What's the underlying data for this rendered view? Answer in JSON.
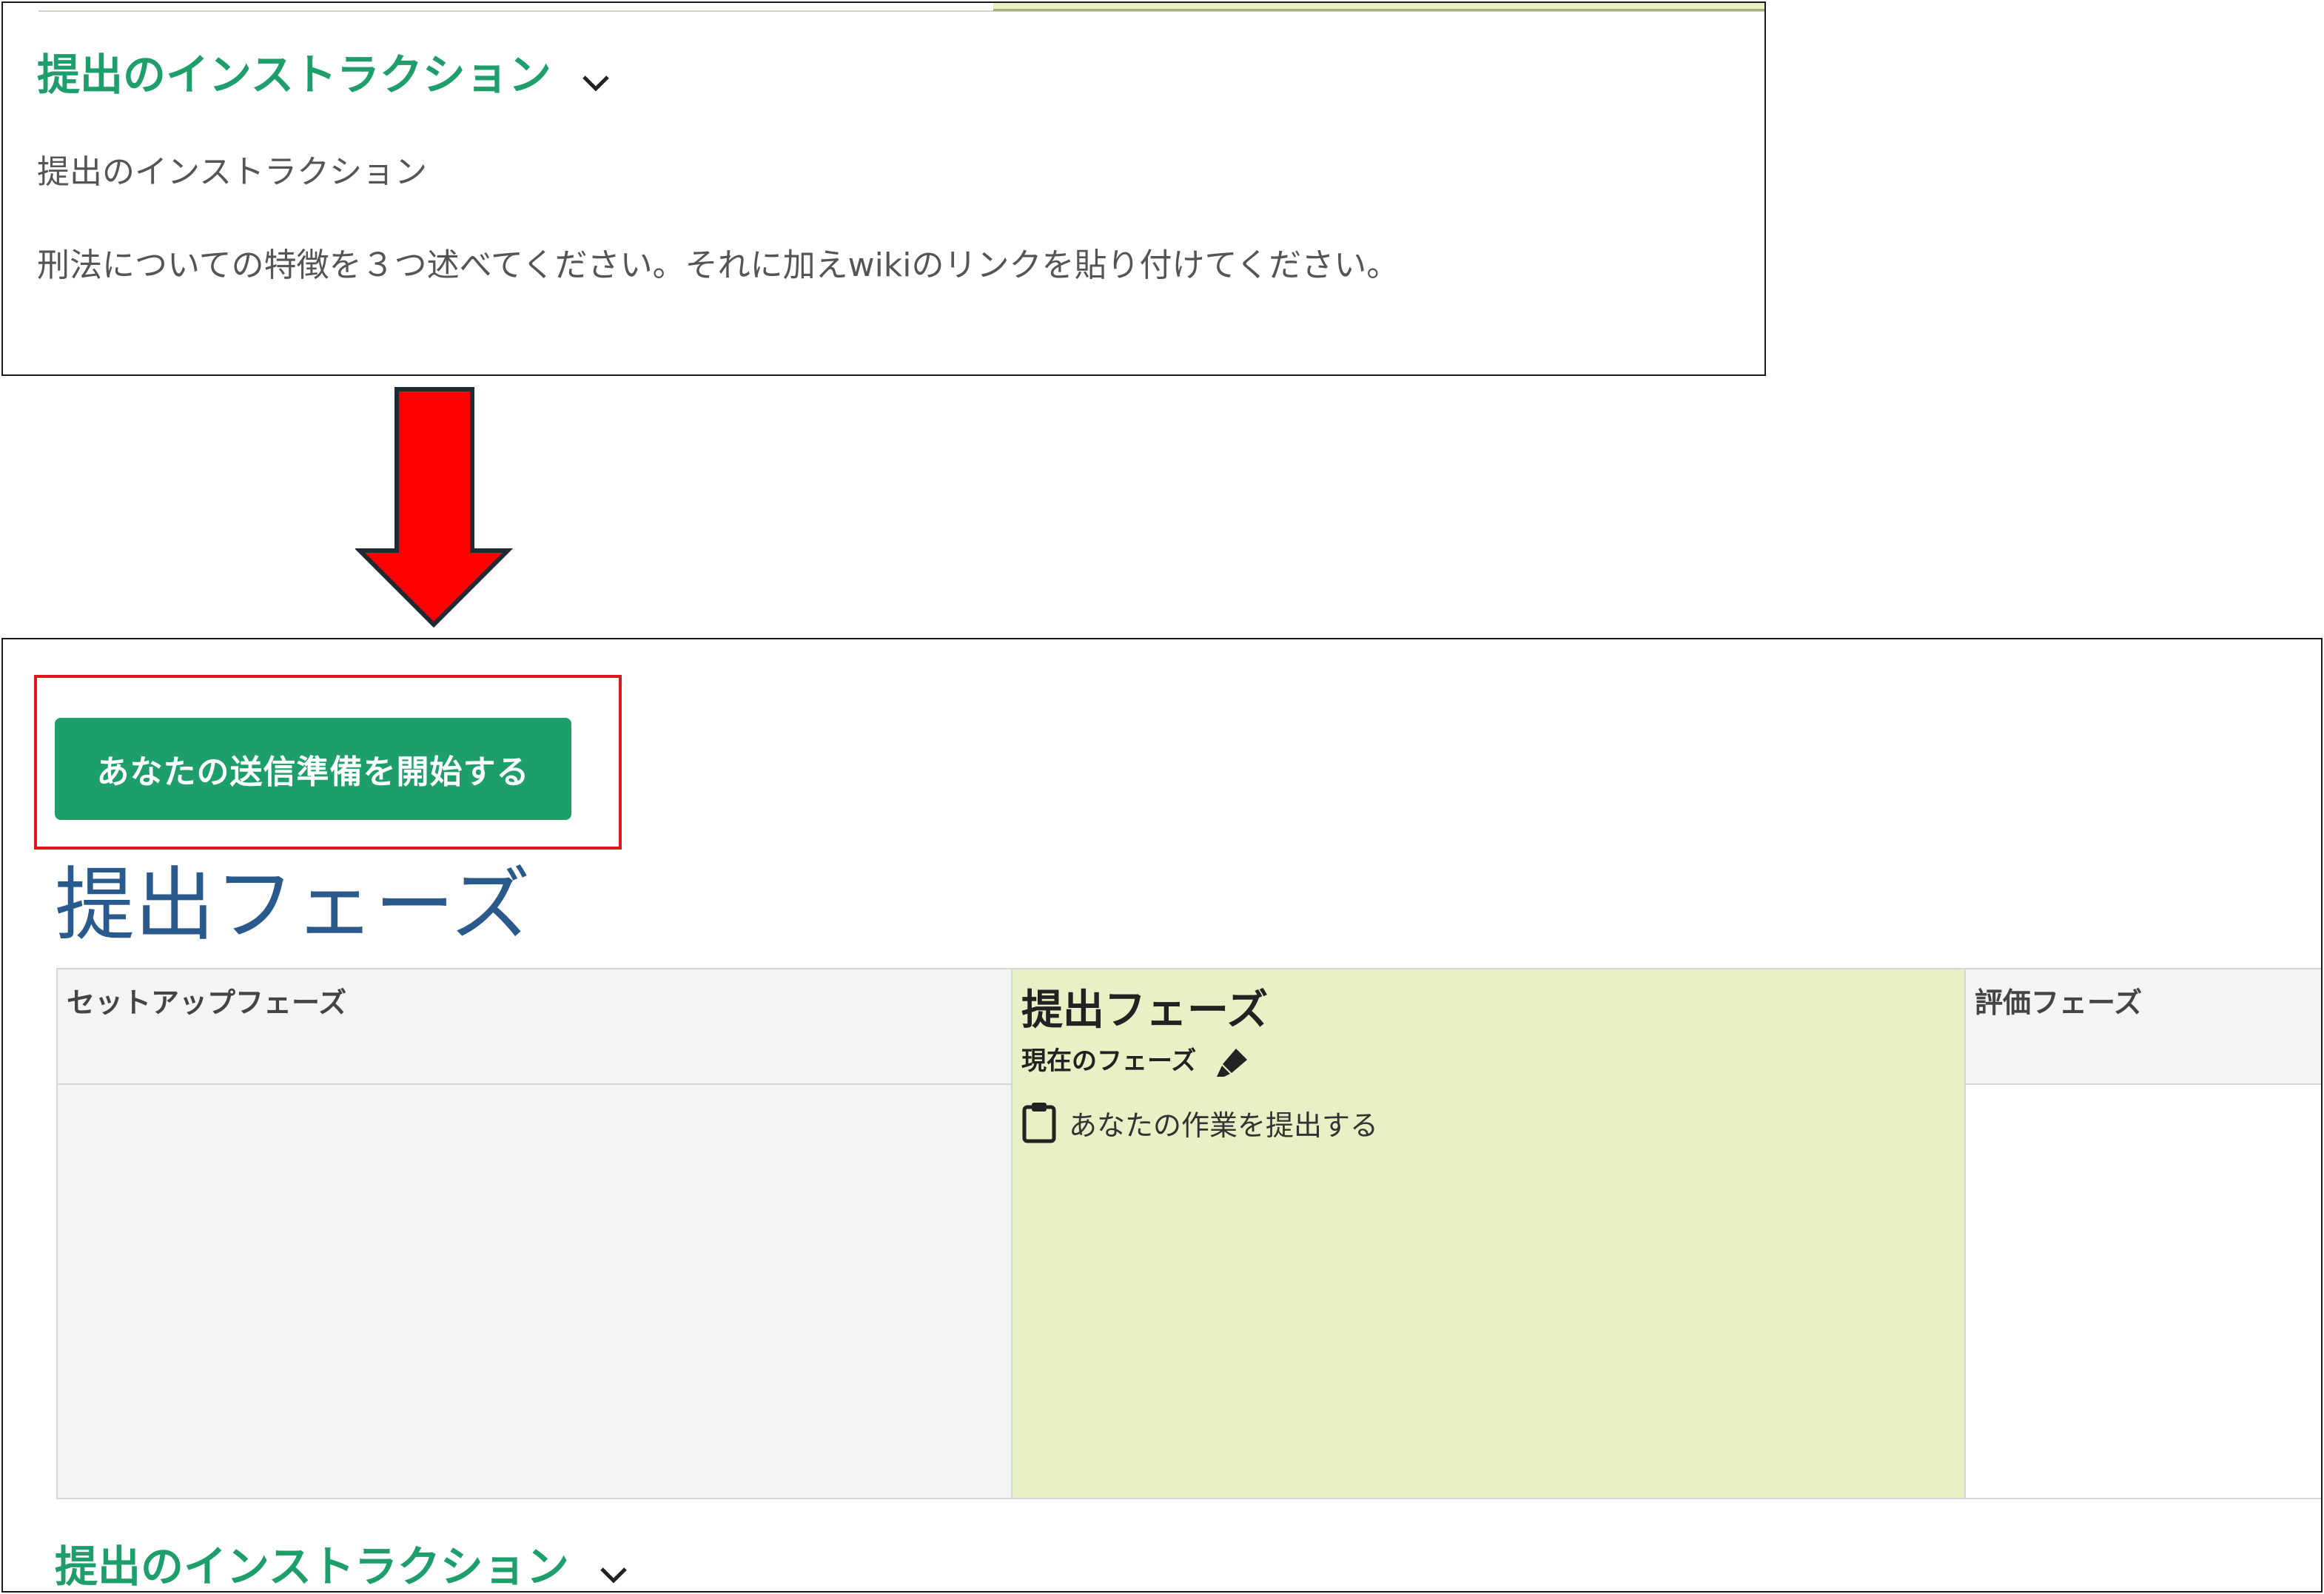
{
  "before": {
    "instructions_heading": "提出のインストラクション",
    "instructions_subheading": "提出のインストラクション",
    "instructions_body": "刑法についての特徴を３つ述べてください。それに加えwikiのリンクを貼り付けてください。"
  },
  "after": {
    "start_button_label": "あなたの送信準備を開始する",
    "page_heading": "提出フェーズ",
    "phases": {
      "setup": {
        "name": "セットアップフェーズ"
      },
      "submission": {
        "name": "提出フェーズ",
        "current_label": "現在のフェーズ",
        "task_label": "あなたの作業を提出する"
      },
      "assessment": {
        "name": "評価フェーズ"
      }
    },
    "instructions_heading": "提出のインストラクション"
  },
  "colors": {
    "accent_green": "#1e9e6a",
    "current_phase_bg": "#e8f0c6",
    "highlight_red": "#e4141b",
    "arrow_red": "#ff0000",
    "heading_blue": "#2a5a8c"
  },
  "icons": {
    "chevron": "chevron-down-icon",
    "current_phase": "highlighter-icon",
    "task": "clipboard-icon",
    "arrow": "arrow-down-icon"
  }
}
